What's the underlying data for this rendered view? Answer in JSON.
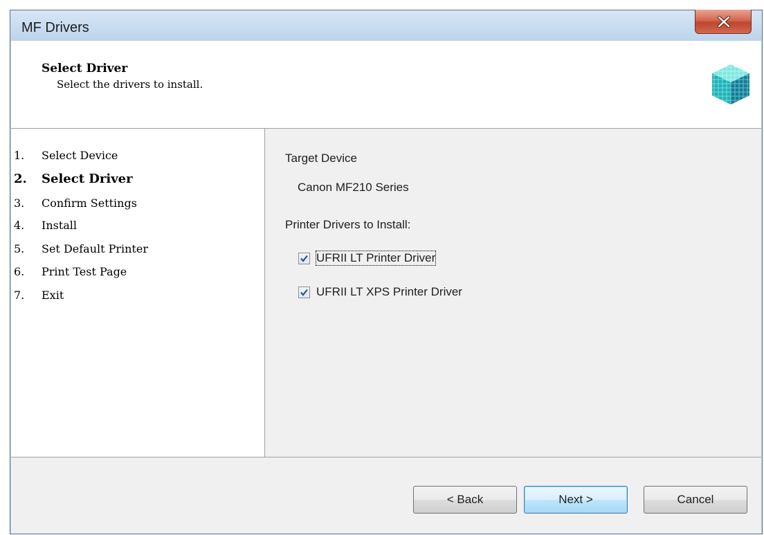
{
  "window": {
    "title": "MF Drivers",
    "close_glyph": "X"
  },
  "header": {
    "title": "Select Driver",
    "subtitle": "Select the drivers to install.",
    "icon": "canon-cube-icon"
  },
  "steps": [
    {
      "num": "1.",
      "label": "Select Device",
      "active": false
    },
    {
      "num": "2.",
      "label": "Select Driver",
      "active": true
    },
    {
      "num": "3.",
      "label": "Confirm Settings",
      "active": false
    },
    {
      "num": "4.",
      "label": "Install",
      "active": false
    },
    {
      "num": "5.",
      "label": "Set Default Printer",
      "active": false
    },
    {
      "num": "6.",
      "label": "Print Test Page",
      "active": false
    },
    {
      "num": "7.",
      "label": "Exit",
      "active": false
    }
  ],
  "content": {
    "target_label": "Target Device",
    "target_value": "Canon MF210 Series",
    "drivers_label": "Printer Drivers to Install:",
    "drivers": [
      {
        "label": "UFRII LT Printer Driver",
        "checked": true,
        "focused": true
      },
      {
        "label": "UFRII LT XPS Printer Driver",
        "checked": true,
        "focused": false
      }
    ]
  },
  "buttons": {
    "back": "< Back",
    "next": "Next >",
    "cancel": "Cancel"
  },
  "colors": {
    "title_bar": "#bfd6ee",
    "close_button": "#c0452f",
    "panel": "#f0f0f0",
    "default_button": "#bee6fd"
  }
}
